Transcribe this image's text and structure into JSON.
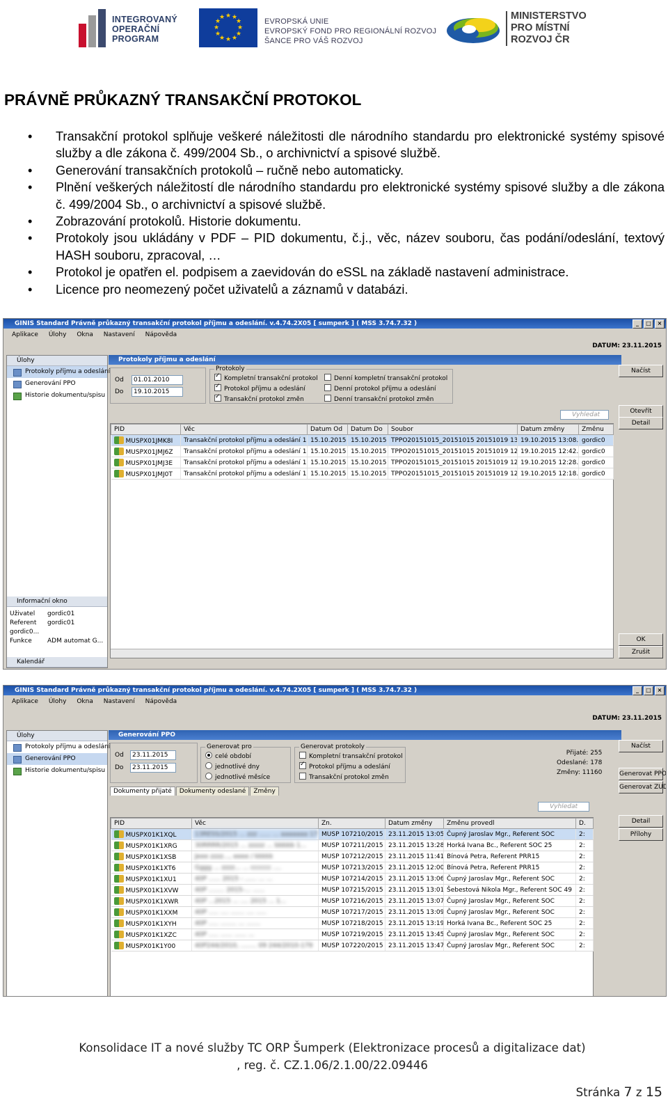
{
  "header": {
    "iop_lines": [
      "INTEGROVANÝ",
      "OPERAČNÍ",
      "PROGRAM"
    ],
    "eu_lines": [
      "EVROPSKÁ UNIE",
      "EVROPSKÝ FOND PRO REGIONÁLNÍ ROZVOJ",
      "ŠANCE PRO VÁŠ ROZVOJ"
    ],
    "mmr_lines": [
      "MINISTERSTVO",
      "PRO MÍSTNÍ",
      "ROZVOJ ČR"
    ],
    "colors": {
      "iop_bar1": "#c8102e",
      "iop_bar2": "#9a9a9a",
      "iop_bar3": "#3c4a6e",
      "eu_blue": "#0f3d9c",
      "eu_star": "#ffcc00"
    }
  },
  "title": "PRÁVNĚ PRŮKAZNÝ TRANSAKČNÍ PROTOKOL",
  "bullets": [
    "Transakční protokol splňuje veškeré náležitosti dle národního standardu pro elektronické systémy spisové služby a dle zákona č. 499/2004 Sb., o archivnictví a spisové službě.",
    "Generování transakčních protokolů – ručně nebo automaticky.",
    "Plnění veškerých náležitostí dle národního standardu pro elektronické systémy spisové služby a dle zákona č. 499/2004 Sb., o archivnictví a spisové službě.",
    "Zobrazování protokolů. Historie dokumentu.",
    "Protokoly jsou ukládány v PDF – PID dokumentu, č.j., věc, název souboru, čas podání/odeslání, textový HASH souboru, zpracoval, …",
    "Protokol je opatřen el. podpisem a zaevidován do eSSL na základě nastavení administrace.",
    "Licence pro neomezený počet uživatelů a záznamů v databázi."
  ],
  "shot1": {
    "title": "GINIS Standard Právně průkazný transakční protokol příjmu a odeslání. v.4.74.2X05 [ sumperk ] ( MSS 3.74.7.32 )",
    "menu": [
      "Aplikace",
      "Úlohy",
      "Okna",
      "Nastavení",
      "Nápověda"
    ],
    "date": "DATUM:   23.11.2015",
    "left_header": "Úlohy",
    "nav": [
      "Protokoly příjmu a odeslání",
      "Generování PPO",
      "Historie dokumentu/spisu"
    ],
    "info_header": "Informační okno",
    "info": [
      [
        "Uživatel",
        "gordic01"
      ],
      [
        "Referent",
        "gordic01 gordic0..."
      ],
      [
        "Funkce",
        "ADM automat  G..."
      ]
    ],
    "calendar": "Kalendář",
    "panel_title": "Protokoly příjmu a odeslání",
    "od_label": "Od",
    "od_value": "01.01.2010",
    "do_label": "Do",
    "do_value": "19.10.2015",
    "group_title": "Protokoly",
    "checks_left": [
      [
        "Kompletní transakční protokol",
        true
      ],
      [
        "Protokol příjmu a odeslání",
        true
      ],
      [
        "Transakční protokol změn",
        true
      ]
    ],
    "checks_right": [
      [
        "Denní kompletní transakční protokol",
        false
      ],
      [
        "Denní protokol příjmu a odeslání",
        false
      ],
      [
        "Denní transakční protokol změn",
        false
      ]
    ],
    "search": "Vyhledat",
    "columns": [
      "PID",
      "Věc",
      "Datum Od",
      "Datum Do",
      "Soubor",
      "Datum změny",
      "Změnu"
    ],
    "rows": [
      [
        "MUSPX01JMK8I",
        "Transakční protokol příjmu a odeslání 15.1...",
        "15.10.2015",
        "15.10.2015",
        "TPPO20151015_20151015 20151019 13...",
        "19.10.2015 13:08...",
        "gordic0"
      ],
      [
        "MUSPX01JMJ6Z",
        "Transakční protokol příjmu a odeslání 15.1...",
        "15.10.2015",
        "15.10.2015",
        "TPPO20151015_20151015 20151019 12...",
        "19.10.2015 12:42...",
        "gordic0"
      ],
      [
        "MUSPX01JMJ3E",
        "Transakční protokol příjmu a odeslání 15.1...",
        "15.10.2015",
        "15.10.2015",
        "TPPO20151015_20151015 20151019 12...",
        "19.10.2015 12:28...",
        "gordic0"
      ],
      [
        "MUSPX01JMJ0T",
        "Transakční protokol příjmu a odeslání 15.1...",
        "15.10.2015",
        "15.10.2015",
        "TPPO20151015_20151015 20151019 12...",
        "19.10.2015 12:18...",
        "gordic0"
      ]
    ],
    "buttons_top": [
      "Načíst"
    ],
    "buttons_mid": [
      "Otevřít",
      "Detail"
    ],
    "buttons_bottom": [
      "OK",
      "Zrušit"
    ]
  },
  "shot2": {
    "title": "GINIS Standard Právně průkazný transakční protokol příjmu a odeslání. v.4.74.2X05 [ sumperk ] ( MSS 3.74.7.32 )",
    "menu": [
      "Aplikace",
      "Úlohy",
      "Okna",
      "Nastavení",
      "Nápověda"
    ],
    "date": "DATUM:   23.11.2015",
    "left_header": "Úlohy",
    "nav": [
      "Protokoly příjmu a odeslání",
      "Generování PPO",
      "Historie dokumentu/spisu"
    ],
    "panel_title": "Generování PPO",
    "od_label": "Od",
    "od_value": "23.11.2015",
    "do_label": "Do",
    "do_value": "23.11.2015",
    "gen_pro_title": "Generovat pro",
    "radios": [
      [
        "celé období",
        true
      ],
      [
        "jednotlivé dny",
        false
      ],
      [
        "jednotlivé měsíce",
        false
      ]
    ],
    "gen_prot_title": "Generovat protokoly",
    "checks": [
      [
        "Kompletní transakční protokol",
        false
      ],
      [
        "Protokol příjmu a odeslání",
        true
      ],
      [
        "Transakční protokol změn",
        false
      ]
    ],
    "stats": [
      "Přijaté: 255",
      "Odeslané: 178",
      "Změny: 11160"
    ],
    "tabs": [
      "Dokumenty přijaté",
      "Dokumenty odeslané",
      "Změny"
    ],
    "search": "Vyhledat",
    "columns": [
      "PID",
      "Věc",
      "Zn.",
      "Datum změny",
      "Změnu provedl",
      "D."
    ],
    "rows": [
      [
        "MUSPX01K1XQL",
        "13RESS/2015 ... zzz ...... ... aaaaaaa 17 ...",
        "MUSP 107210/2015",
        "23.11.2015 13:05...",
        "Čupný Jaroslav Mgr., Referent SOC",
        "2:"
      ],
      [
        "MUSPX01K1XRG",
        "30RRRR/2015 ... zzzzz ... bbbbb 1...",
        "MUSP 107211/2015",
        "23.11.2015 13:28...",
        "Horká Ivana Bc., Referent SOC 25",
        "2:"
      ],
      [
        "MUSPX01K1XSB",
        "Jeee zzzz..., eeee / kkkkk",
        "MUSP 107212/2015",
        "23.11.2015 11:41...",
        "Bínová Petra, Referent PRR15",
        "2:"
      ],
      [
        "MUSPX01K1XT6",
        "Gggg ... zzzz... ... cccccc ....",
        "MUSP 107213/2015",
        "23.11.2015 12:00...",
        "Bínová Petra, Referent PRR15",
        "2:"
      ],
      [
        "MUSPX01K1XU1",
        "40P ...... 2015 - ...... ... ...",
        "MUSP 107214/2015",
        "23.11.2015 13:06...",
        "Čupný Jaroslav Mgr., Referent SOC",
        "2:"
      ],
      [
        "MUSPX01K1XVW",
        "40P ........ 2015-... ......",
        "MUSP 107215/2015",
        "23.11.2015 13:01...",
        "Šebestová Nikola Mgr., Referent SOC 49",
        "2:"
      ],
      [
        "MUSPX01K1XWR",
        "40P ...2015 ... .... 2015 ... 1...",
        "MUSP 107216/2015",
        "23.11.2015 13:07...",
        "Čupný Jaroslav Mgr., Referent SOC",
        "2:"
      ],
      [
        "MUSPX01K1XXM",
        "40P ..... .... ....... .... .....",
        "MUSP 107217/2015",
        "23.11.2015 13:09...",
        "Čupný Jaroslav Mgr., Referent SOC",
        "2:"
      ],
      [
        "MUSPX01K1XYH",
        "40P ..... ........ ... .......",
        "MUSP 107218/2015",
        "23.11.2015 13:19...",
        "Horká Ivana Bc., Referent SOC 25",
        "2:"
      ],
      [
        "MUSPX01K1XZC",
        "40P ..... ...... ...... ...",
        "MUSP 107219/2015",
        "23.11.2015 13:45...",
        "Čupný Jaroslav Mgr., Referent SOC",
        "2:"
      ],
      [
        "MUSPX01K1Y00",
        "40P244/2010, ........ 09 244/2010-179",
        "MUSP 107220/2015",
        "23.11.2015 13:47...",
        "Čupný Jaroslav Mgr., Referent SOC",
        "2:"
      ]
    ],
    "buttons_top": [
      "Načíst"
    ],
    "buttons_mid": [
      "Generovat PPO",
      "Generovat ZUD"
    ],
    "buttons_lower": [
      "Detail",
      "Přílohy"
    ]
  },
  "footer": {
    "line1": "Konsolidace IT a nové služby TC ORP Šumperk (Elektronizace procesů a digitalizace dat)",
    "line2": ", reg. č. CZ.1.06/2.1.00/22.09446",
    "page_prefix": "Stránka",
    "page_num": "7",
    "page_sep": "z",
    "page_total": "15"
  }
}
